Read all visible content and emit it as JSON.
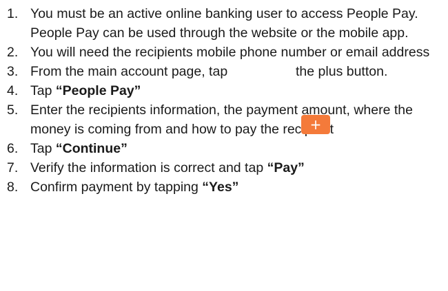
{
  "steps": [
    {
      "number": "1.",
      "text": "You must be an active online banking user to access People Pay.  People Pay can be used through the website or the mobile app."
    },
    {
      "number": "2.",
      "text": "You will need the recipients mobile phone number or email address"
    },
    {
      "number": "3.",
      "text_before": "From the main account page, tap",
      "text_after": "the plus button."
    },
    {
      "number": "4.",
      "text": "Tap ",
      "bold": "“People Pay”"
    },
    {
      "number": "5.",
      "text": "Enter the recipients information, the payment amount, where the money is coming from and how to pay the recipient"
    },
    {
      "number": "6.",
      "text": "Tap ",
      "bold": "“Continue”"
    },
    {
      "number": "7.",
      "text": "Verify the information is correct and tap ",
      "bold": "“Pay”"
    },
    {
      "number": "8.",
      "text": "Confirm payment by tapping ",
      "bold": "“Yes”"
    }
  ],
  "plus_button": {
    "glyph": "+",
    "icon": "plus-icon",
    "color": "#f47a3a"
  }
}
